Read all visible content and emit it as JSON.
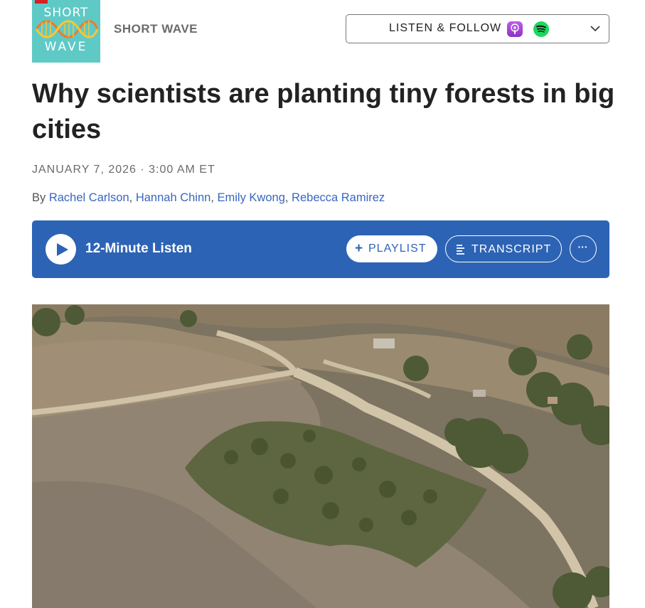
{
  "header": {
    "logo_top": "SHORT",
    "logo_bottom": "WAVE",
    "podcast_name": "SHORT WAVE",
    "listen_follow_label": "LISTEN & FOLLOW",
    "icons": [
      "apple-podcasts-icon",
      "spotify-icon",
      "chevron-down-icon"
    ]
  },
  "article": {
    "title": "Why scientists are planting tiny forests in big cities",
    "date": "JANUARY 7, 2026 · 3:00 AM ET",
    "byline_prefix": "By ",
    "authors": [
      "Rachel Carlson",
      "Hannah Chinn",
      "Emily Kwong",
      "Rebecca Ramirez"
    ],
    "separator": ", "
  },
  "player": {
    "duration_label": "12-Minute Listen",
    "playlist_label": "PLAYLIST",
    "transcript_label": "TRANSCRIPT",
    "more_label": "···"
  },
  "colors": {
    "player_bg": "#2d63b5",
    "link": "#3a66c0",
    "logo_bg": "#5fc9c6"
  }
}
